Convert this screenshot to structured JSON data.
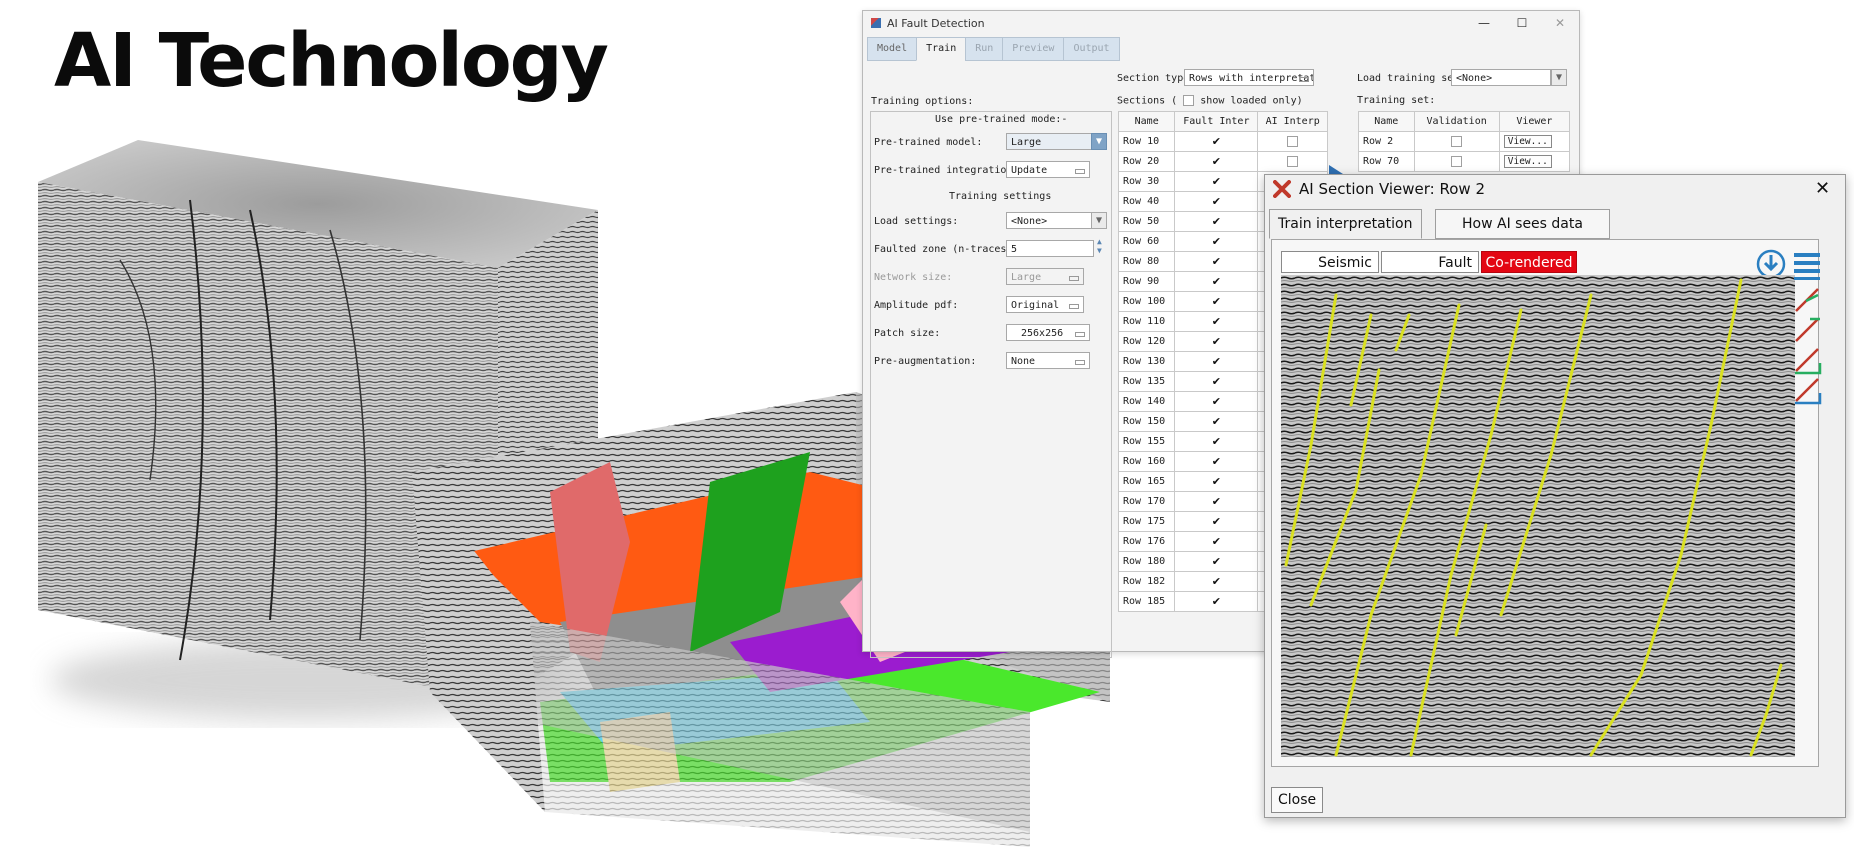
{
  "headline": "AI Technology",
  "main_window": {
    "title": "AI Fault Detection",
    "tabs": [
      {
        "label": "Model"
      },
      {
        "label": "Train"
      },
      {
        "label": "Run"
      },
      {
        "label": "Preview"
      },
      {
        "label": "Output"
      }
    ],
    "active_tab": "Train",
    "training_options_label": "Training options:",
    "use_pretrained_label": "Use pre-trained mode:-",
    "pretrained_model": {
      "label": "Pre-trained model:",
      "value": "Large"
    },
    "pretrained_integration": {
      "label": "Pre-trained integration:",
      "value": "Update"
    },
    "training_settings_label": "Training settings",
    "load_settings": {
      "label": "Load settings:",
      "value": "<None>"
    },
    "faulted_zone": {
      "label": "Faulted zone (n-traces):",
      "value": "5"
    },
    "network_size": {
      "label": "Network size:",
      "value": "Large"
    },
    "amplitude_pdf": {
      "label": "Amplitude pdf:",
      "value": "Original"
    },
    "patch_size": {
      "label": "Patch size:",
      "value": "256x256"
    },
    "pre_augmentation": {
      "label": "Pre-augmentation:",
      "value": "None"
    },
    "section_type": {
      "label": "Section type:",
      "value": "Rows with interpretation"
    },
    "sections_label": "Sections (",
    "show_loaded_label": "show loaded only)",
    "sections_columns": [
      "Name",
      "Fault Inter",
      "AI Interp"
    ],
    "sections_rows": [
      "Row 10",
      "Row 20",
      "Row 30",
      "Row 40",
      "Row 50",
      "Row 60",
      "Row 80",
      "Row 90",
      "Row 100",
      "Row 110",
      "Row 120",
      "Row 130",
      "Row 135",
      "Row 140",
      "Row 150",
      "Row 155",
      "Row 160",
      "Row 165",
      "Row 170",
      "Row 175",
      "Row 176",
      "Row 180",
      "Row 182",
      "Row 185"
    ],
    "load_training_set": {
      "label": "Load training set:",
      "value": "<None>"
    },
    "training_set_label": "Training set:",
    "training_columns": [
      "Name",
      "Validation",
      "Viewer"
    ],
    "training_rows": [
      {
        "name": "Row 2",
        "viewer": "View..."
      },
      {
        "name": "Row 70",
        "viewer": "View..."
      }
    ]
  },
  "viewer_window": {
    "title": "AI Section Viewer: Row 2",
    "close_x": "✕",
    "tabs": [
      "Train interpretation",
      "How AI sees data"
    ],
    "mode_buttons": [
      "Seismic",
      "Fault",
      "Co-rendered"
    ],
    "close_button": "Close"
  },
  "colors": {
    "accent_red": "#e30613",
    "tab_blue": "#d6e2ee",
    "fault_yellow": "#d9e021",
    "icon_blue": "#2a7fc1"
  },
  "icons": [
    "app-icon",
    "x-logo-icon",
    "download-icon",
    "list-icon",
    "pick-icon"
  ]
}
